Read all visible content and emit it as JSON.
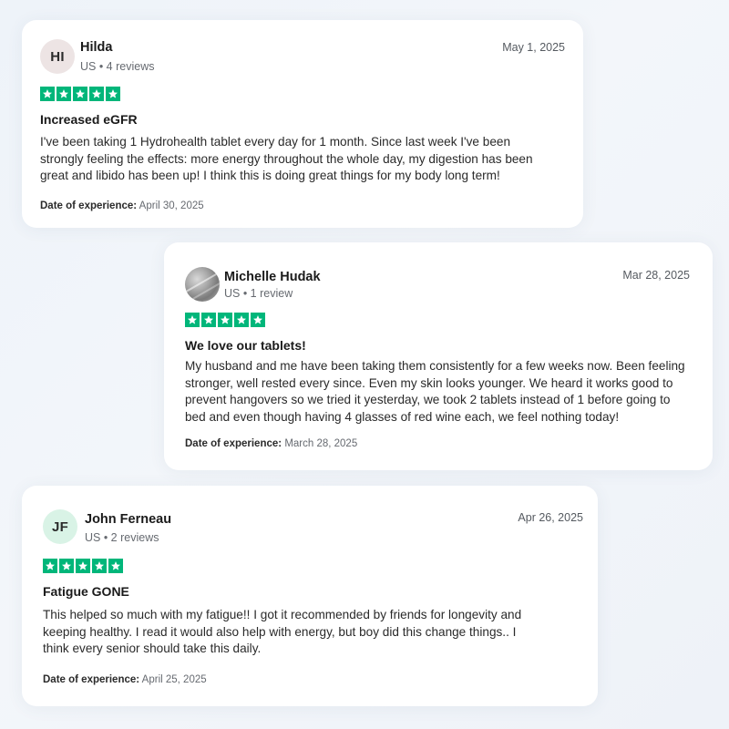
{
  "reviews": [
    {
      "avatar_initials": "HI",
      "avatar_color": "#ede4e4",
      "name": "Hilda",
      "meta": "US • 4 reviews",
      "date": "May 1, 2025",
      "rating": 5,
      "title": "Increased eGFR",
      "body_lines": [
        "I've been taking 1 Hydrohealth tablet every day for 1 month. Since last week I've been",
        "strongly feeling the effects: more energy throughout the whole day, my digestion has been",
        "great and libido has been up! I think this is doing great things for my body long term!"
      ],
      "experience_label": "Date of experience:",
      "experience_date": "April 30, 2025"
    },
    {
      "avatar_initials": "",
      "avatar_color": "#9a9a9a",
      "name": "Michelle Hudak",
      "meta": "US • 1 review",
      "date": "Mar 28, 2025",
      "rating": 5,
      "title": "We love our tablets!",
      "body_lines": [
        "My husband and me have been taking them consistently for a few weeks now. Been feeling",
        "stronger, well rested every since. Even my skin looks younger. We heard it works good to",
        "prevent hangovers so we tried it yesterday, we took 2 tablets instead of 1 before going to",
        "bed and even though having 4 glasses of red wine each, we feel nothing today!"
      ],
      "experience_label": "Date of experience:",
      "experience_date": "March 28, 2025"
    },
    {
      "avatar_initials": "JF",
      "avatar_color": "#d9f3e6",
      "name": "John Ferneau",
      "meta": "US • 2 reviews",
      "date": "Apr 26, 2025",
      "rating": 5,
      "title": "Fatigue GONE",
      "body_lines": [
        "This helped so much with my fatigue!! I got it recommended by friends for longevity and",
        "keeping healthy. I read it would also help with energy, but boy did this change things.. I",
        "think every senior should take this daily."
      ],
      "experience_label": "Date of experience:",
      "experience_date": "April 25, 2025"
    }
  ],
  "colors": {
    "star_green": "#00b67a",
    "card_bg": "#ffffff"
  }
}
